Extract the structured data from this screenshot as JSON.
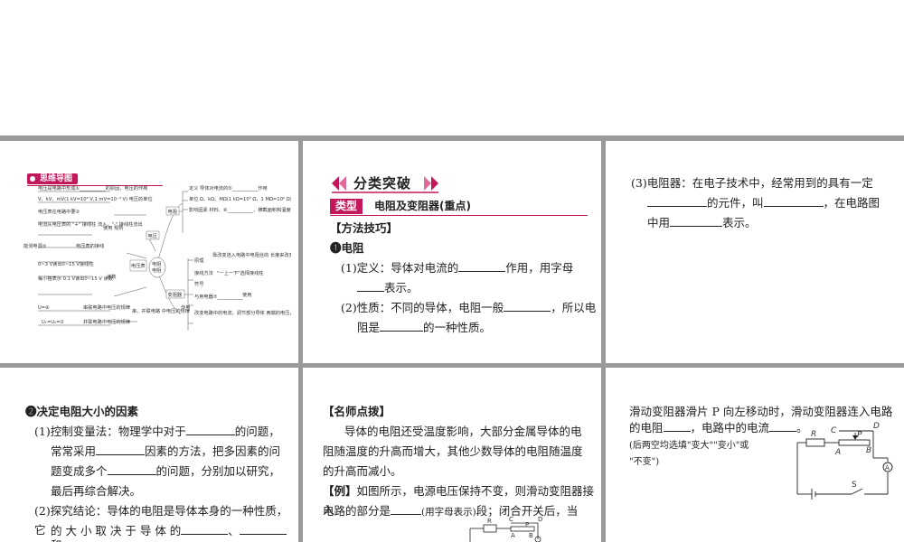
{
  "mindmap": {
    "title": "思维导图",
    "center": "电阻\n电阻",
    "nodes": {
      "voltage": "电压",
      "resistance": "电阻",
      "rheostat": "变阻器",
      "voltmeter": "电压表"
    },
    "left_items": [
      "电压是电路中形成①___________的原因，电压的作用",
      "V、kV、mV(1 kV=10³ V,1 mV=10⁻³ V)  电压的单位",
      "电压表在电路中要②",
      "电流从电压表的 \"+\" 接线柱\n流入，\"-\" 接线柱流出",
      "使用\n规则",
      "能测电源③",
      "电压表的接线",
      "0~3 V读出0~15 V接线柱",
      "每小格表示\n0.1 V读出0~15 V 读数",
      "读数",
      "U=④",
      "串联电路中电压的规律",
      "U₁=U₂=U",
      "并联电路中电压的规律",
      "串、并联电路\n中电压的规律"
    ],
    "right_items": [
      "定义  导体对电流的⑤___________作用",
      "单位 Ω、kΩ、MΩ(1 kΩ=10³ Ω，1 MΩ=10⁶ Ω)",
      "影响因素  材料、⑥___________、横截面积和温度",
      "原理",
      "靠改变连入电路中电阻丝的\n长度来改变电阻",
      "接线方法",
      "\"一上一下\"选择接线柱",
      "符号",
      "作用",
      "与用电器⑦___________",
      "使用",
      "改变电路中的电流，调节部分导体\n两端的电压，对电路有⑧___________作用"
    ]
  },
  "card2": {
    "banner": "分类突破",
    "type_tag": "类型",
    "type_title": "电阻及变阻器(重点)",
    "method_heading": "【方法技巧】",
    "item1_label": "❶电阻",
    "def_prefix": "(1)定义：导体对电流的",
    "def_mid": "作用，用字母",
    "def_suffix": "表示。",
    "prop_prefix": "(2)性质：不同的导体，电阻一般",
    "prop_mid": "，所以电",
    "prop_line2_prefix": "阻是",
    "prop_line2_suffix": "的一种性质。"
  },
  "card3": {
    "line1": "(3)电阻器：在电子技术中，经常用到的具有一定",
    "line2_mid": "的元件，叫",
    "line2_suffix": "，在电路图",
    "line3_prefix": "中用",
    "line3_suffix": "表示。"
  },
  "card4": {
    "item2_label": "❷决定电阻大小的因素",
    "p1_line1_prefix": "(1)控制变量法：物理学中对于",
    "p1_line1_suffix": "的问题，",
    "p1_line2_prefix": "常常采用",
    "p1_line2_suffix": "因素的方法，把多因素的问",
    "p1_line3_prefix": "题变成多个",
    "p1_line3_suffix": "的问题，分别加以研究，",
    "p1_line4": "最后再综合解决。",
    "p2_line1": "(2)探究结论：导体的电阻是导体本身的一种性质，它",
    "p2_line2_prefix": "的 大 小 取 决 于 导 体 的",
    "p2_line2_sep": "、",
    "p2_line3": "和"
  },
  "card5": {
    "heading": "【名师点拨】",
    "para1_line1": "导体的电阻还受温度影响，大部分金属导体的电",
    "para1_line2": "阻随温度的升高而增大，其他少数导体的电阻随温度",
    "para1_line3": "的升高而减小。",
    "example_label": "【例】",
    "example_line1": "如图所示，电源电压保持不变，则滑动变阻器接入",
    "example_line2_prefix": "电路的部分是",
    "example_line2_note": "(用字母表示)",
    "example_line2_suffix": "段；闭合开关后，当"
  },
  "card6": {
    "line1": "滑动变阻器滑片 P 向左移动时，滑动变阻器连入电路",
    "line2_prefix": "的电阻",
    "line2_mid": "，电路中的电流",
    "line2_suffix": "。",
    "note1": "(后两空均选填\"变大\"\"变小\"或",
    "note2": "\"不变\")",
    "circuit": {
      "R": "R",
      "C": "C",
      "P": "P",
      "D": "D",
      "A": "A",
      "B": "B",
      "ammeter": "A",
      "switch": "S"
    }
  },
  "colors": {
    "accent": "#c2185b",
    "gap": "#9a9a9a"
  }
}
